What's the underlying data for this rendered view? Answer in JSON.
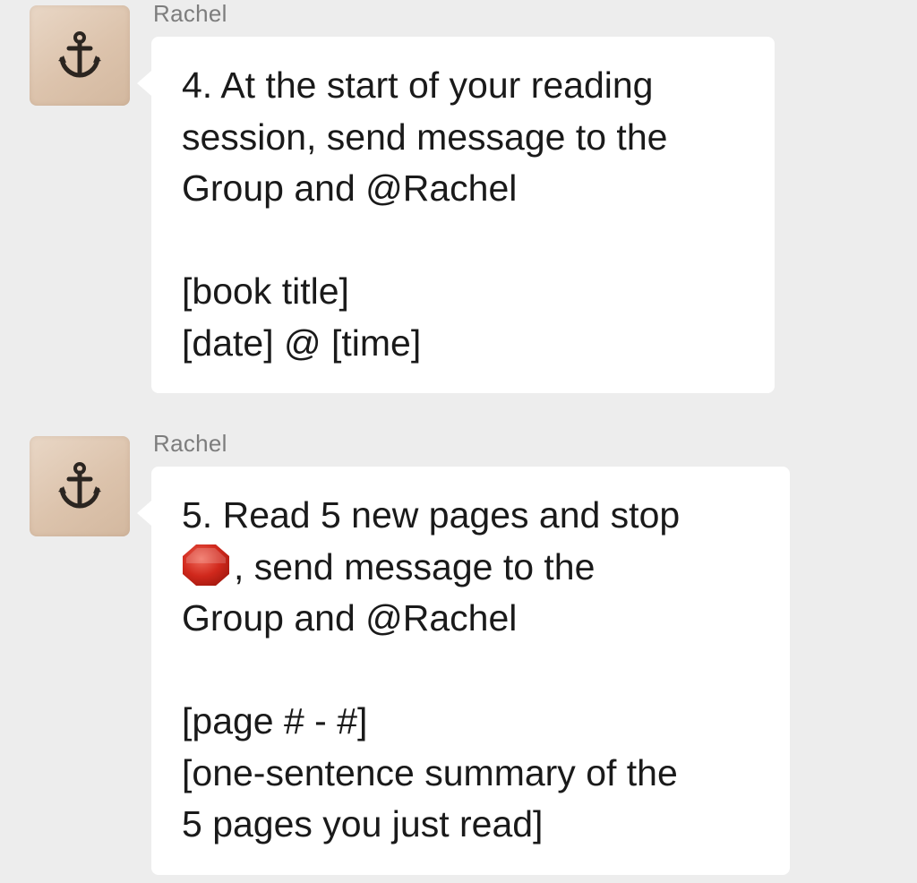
{
  "messages": [
    {
      "sender": "Rachel",
      "avatar_icon": "anchor-icon",
      "lines": [
        "4. At the start of your reading",
        "session, send message to the",
        "Group and @Rachel",
        "",
        "[book title]",
        "[date] @ [time]"
      ]
    },
    {
      "sender": "Rachel",
      "avatar_icon": "anchor-icon",
      "lines": [
        "5. Read 5 new pages and stop",
        ", send message to the",
        "Group and @Rachel",
        "",
        "[page # - #]",
        "[one-sentence summary of the",
        "5 pages you just read]"
      ],
      "inline_icon": "stop-sign-icon"
    }
  ],
  "colors": {
    "background": "#ededed",
    "bubble": "#ffffff",
    "sender_text": "#7d7d7d",
    "message_text": "#1a1a1a",
    "stop_sign": "#d0281c"
  }
}
